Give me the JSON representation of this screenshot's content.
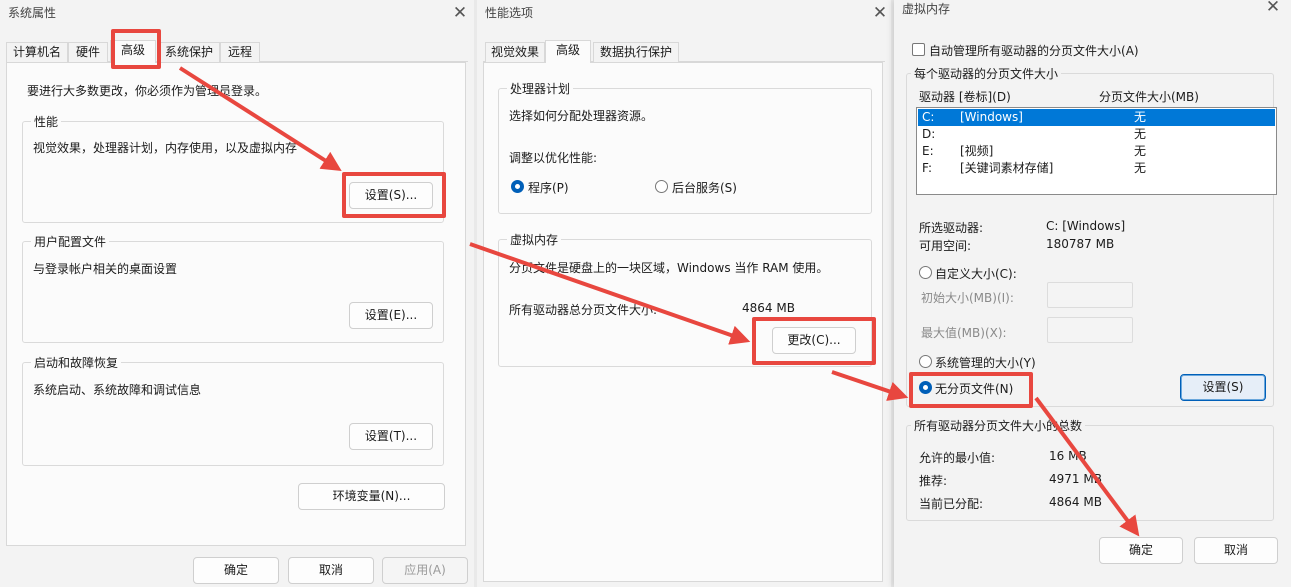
{
  "sys": {
    "title": "系统属性",
    "close": "✕",
    "tabs": [
      "计算机名",
      "硬件",
      "高级",
      "系统保护",
      "远程"
    ],
    "admin_note": "要进行大多数更改，你必须作为管理员登录。",
    "perf": {
      "title": "性能",
      "desc": "视觉效果，处理器计划，内存使用，以及虚拟内存",
      "btn": "设置(S)..."
    },
    "profile": {
      "title": "用户配置文件",
      "desc": "与登录帐户相关的桌面设置",
      "btn": "设置(E)..."
    },
    "startup": {
      "title": "启动和故障恢复",
      "desc": "系统启动、系统故障和调试信息",
      "btn": "设置(T)..."
    },
    "env_btn": "环境变量(N)...",
    "ok": "确定",
    "cancel": "取消",
    "apply": "应用(A)"
  },
  "perf": {
    "title": "性能选项",
    "close": "✕",
    "tabs": [
      "视觉效果",
      "高级",
      "数据执行保护"
    ],
    "sched": {
      "title": "处理器计划",
      "desc": "选择如何分配处理器资源。",
      "adjust": "调整以优化性能:",
      "opt_programs": "程序(P)",
      "opt_services": "后台服务(S)"
    },
    "vm": {
      "title": "虚拟内存",
      "desc": "分页文件是硬盘上的一块区域，Windows 当作 RAM 使用。",
      "total_label": "所有驱动器总分页文件大小:",
      "total_value": "4864 MB",
      "btn": "更改(C)..."
    }
  },
  "vmem": {
    "title": "虚拟内存",
    "close": "✕",
    "auto_label": "自动管理所有驱动器的分页文件大小",
    "auto_key": "(A)",
    "group1": "每个驱动器的分页文件大小",
    "col_drive": "驱动器 [卷标](D)",
    "col_size": "分页文件大小(MB)",
    "drives": [
      {
        "letter": "C:",
        "label": "[Windows]",
        "size": "无"
      },
      {
        "letter": "D:",
        "label": "",
        "size": "无"
      },
      {
        "letter": "E:",
        "label": "[视频]",
        "size": "无"
      },
      {
        "letter": "F:",
        "label": "[关键词素材存储]",
        "size": "无"
      }
    ],
    "sel_drive_label": "所选驱动器:",
    "sel_drive_value": "C:  [Windows]",
    "free_label": "可用空间:",
    "free_value": "180787 MB",
    "custom": "自定义大小(C):",
    "initial": "初始大小(MB)(I):",
    "max": "最大值(MB)(X):",
    "system": "系统管理的大小(Y)",
    "none": "无分页文件(N)",
    "set_btn": "设置(S)",
    "group2": "所有驱动器分页文件大小的总数",
    "min_label": "允许的最小值:",
    "min_value": "16 MB",
    "rec_label": "推荐:",
    "rec_value": "4971 MB",
    "cur_label": "当前已分配:",
    "cur_value": "4864 MB",
    "ok": "确定",
    "cancel": "取消"
  },
  "colors": {
    "accent": "#005fb8",
    "highlight": "#e8473f",
    "selection": "#0078d7"
  }
}
